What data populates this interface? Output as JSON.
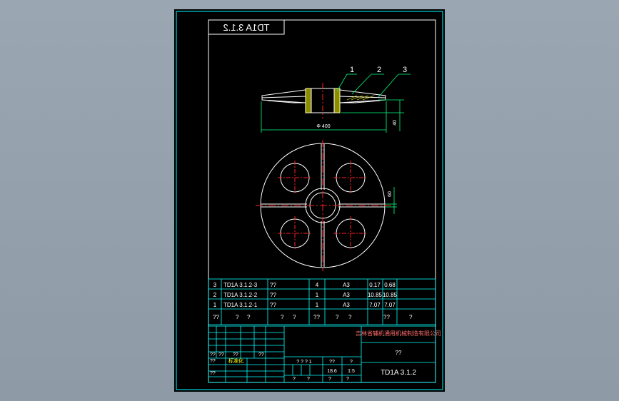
{
  "drawing": {
    "title_block_mirrored": "TD1A 3.1.2",
    "callouts": [
      "1",
      "2",
      "3"
    ],
    "dim_diameter": "Φ 400",
    "dim_height": "40",
    "dim_hub": "60"
  },
  "parts_list": {
    "rows": [
      {
        "no": "3",
        "code": "TD1A 3.1.2-3",
        "name": "??",
        "qty": "4",
        "material": "A3",
        "w1": "0.17",
        "w2": "0.68"
      },
      {
        "no": "2",
        "code": "TD1A 3.1.2-2",
        "name": "??",
        "qty": "1",
        "material": "A3",
        "w1": "10.85",
        "w2": "10.85"
      },
      {
        "no": "1",
        "code": "TD1A 3.1.2-1",
        "name": "??",
        "qty": "1",
        "material": "A3",
        "w1": "7.07",
        "w2": "7.07"
      }
    ],
    "header": [
      "??",
      "?",
      "?",
      "?",
      "?",
      "??",
      "?",
      "?",
      "??",
      "?"
    ]
  },
  "title_block": {
    "company": "吉林省辅机通用机械制造有限公司",
    "drawing_name": "??",
    "drawing_no": "TD1A 3.1.2",
    "scale_label": "??",
    "scale": "1:5",
    "weight": "18.6",
    "left_labels": [
      "??",
      "??",
      "??",
      "??",
      "??",
      "??"
    ],
    "std_label": "标准化",
    "bottom_cells": [
      "?",
      "?",
      "?",
      "?"
    ],
    "mid_cells": [
      "? ? ? 1",
      "??",
      "?"
    ]
  },
  "colors": {
    "line": "#ffffff",
    "border": "#00ffff",
    "center": "#ff2020",
    "section": "#ffff00",
    "dimension": "#00ff7f"
  }
}
